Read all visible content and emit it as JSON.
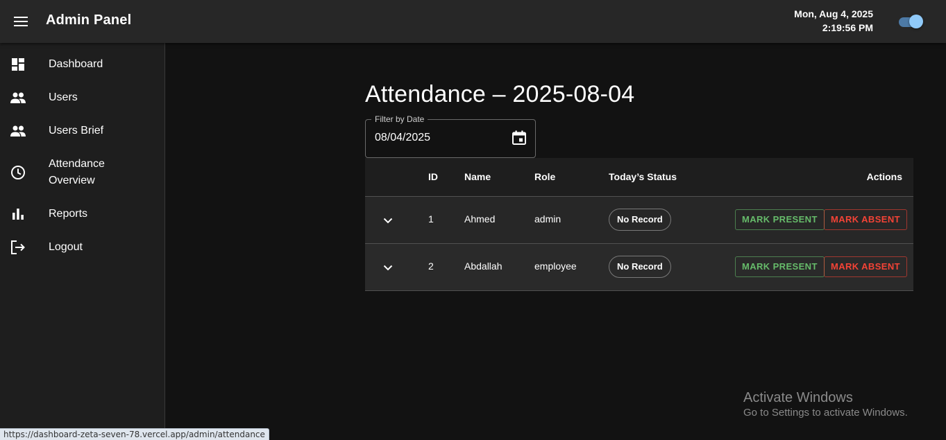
{
  "header": {
    "title": "Admin Panel",
    "date": "Mon, Aug 4, 2025",
    "time": "2:19:56 PM",
    "menu_icon": "menu-icon",
    "theme_toggle_on": true
  },
  "sidebar": {
    "items": [
      {
        "label": "Dashboard",
        "icon": "dashboard-icon"
      },
      {
        "label": "Users",
        "icon": "people-icon"
      },
      {
        "label": "Users Brief",
        "icon": "people-icon"
      },
      {
        "label_line1": "Attendance",
        "label_line2": "Overview",
        "icon": "clock-icon"
      },
      {
        "label": "Reports",
        "icon": "bar-chart-icon"
      },
      {
        "label": "Logout",
        "icon": "logout-icon"
      }
    ]
  },
  "main": {
    "title": "Attendance – 2025-08-04",
    "filter": {
      "label": "Filter by Date",
      "value": "08/04/2025",
      "icon": "calendar-icon"
    },
    "table": {
      "headers": {
        "id": "ID",
        "name": "Name",
        "role": "Role",
        "status": "Today’s Status",
        "actions": "Actions"
      },
      "rows": [
        {
          "id": "1",
          "name": "Ahmed",
          "role": "admin",
          "status": "No Record",
          "present_label": "MARK PRESENT",
          "absent_label": "MARK ABSENT"
        },
        {
          "id": "2",
          "name": "Abdallah",
          "role": "employee",
          "status": "No Record",
          "present_label": "MARK PRESENT",
          "absent_label": "MARK ABSENT"
        }
      ]
    }
  },
  "watermark": {
    "line1": "Activate Windows",
    "line2": "Go to Settings to activate Windows."
  },
  "statusbar": {
    "url": "https://dashboard-zeta-seven-78.vercel.app/admin/attendance"
  },
  "colors": {
    "present": "#66bb6a",
    "absent": "#f44336",
    "toggle": "#90caf9",
    "background": "#121212",
    "appbar": "#272727",
    "sidebar": "#1e1e1e"
  }
}
